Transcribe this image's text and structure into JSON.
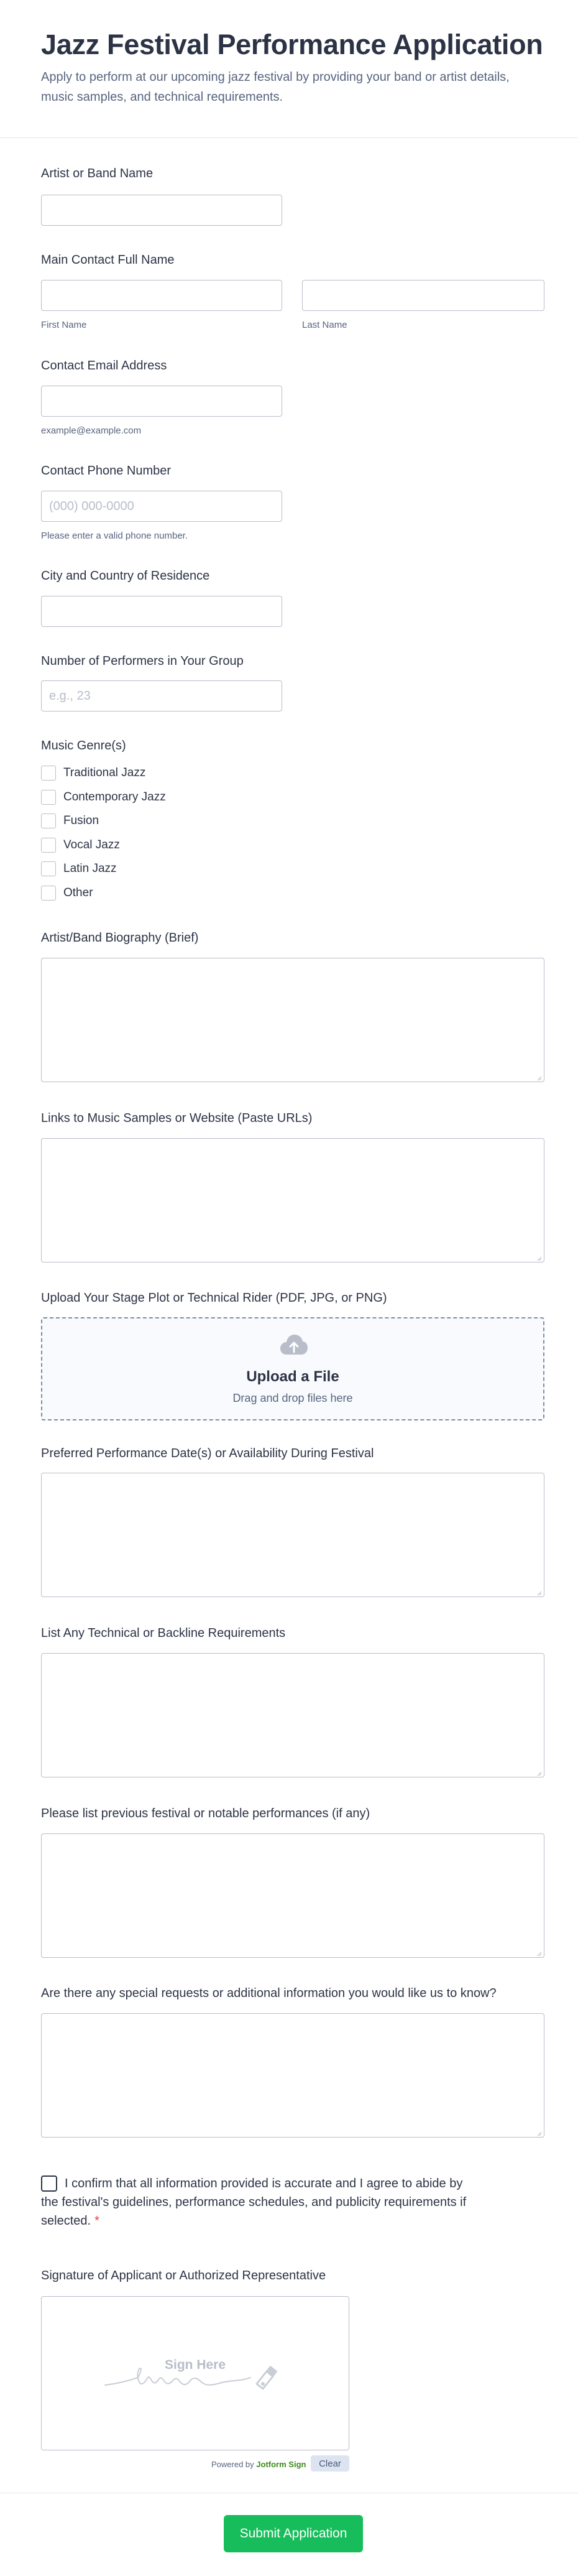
{
  "form": {
    "title": "Jazz Festival Performance Application",
    "subtitle": "Apply to perform at our upcoming jazz festival by providing your band or artist details, music samples, and technical requirements."
  },
  "fields": {
    "artist_name": {
      "label": "Artist or Band Name",
      "value": ""
    },
    "contact_name": {
      "label": "Main Contact Full Name",
      "first_sublabel": "First Name",
      "last_sublabel": "Last Name"
    },
    "email": {
      "label": "Contact Email Address",
      "sublabel": "example@example.com"
    },
    "phone": {
      "label": "Contact Phone Number",
      "placeholder": "(000) 000-0000",
      "sublabel": "Please enter a valid phone number."
    },
    "city": {
      "label": "City and Country of Residence"
    },
    "performers": {
      "label": "Number of Performers in Your Group",
      "placeholder": "e.g., 23"
    },
    "genres": {
      "label": "Music Genre(s)",
      "options": [
        "Traditional Jazz",
        "Contemporary Jazz",
        "Fusion",
        "Vocal Jazz",
        "Latin Jazz",
        "Other"
      ]
    },
    "biography": {
      "label": "Artist/Band Biography (Brief)"
    },
    "links": {
      "label": "Links to Music Samples or Website (Paste URLs)"
    },
    "upload": {
      "label": "Upload Your Stage Plot or Technical Rider (PDF, JPG, or PNG)",
      "title": "Upload a File",
      "hint": "Drag and drop files here",
      "icon": "cloud-upload-icon"
    },
    "dates": {
      "label": "Preferred Performance Date(s) or Availability During Festival"
    },
    "technical": {
      "label": "List Any Technical or Backline Requirements"
    },
    "previous": {
      "label": "Please list previous festival or notable performances (if any)"
    },
    "special": {
      "label": "Are there any special requests or additional information you would like us to know?"
    },
    "consent": {
      "text": "I confirm that all information provided is accurate and I agree to abide by the festival's guidelines, performance schedules, and publicity requirements if selected.",
      "required_mark": "*"
    },
    "signature": {
      "label": "Signature of Applicant or Authorized Representative",
      "placeholder": "Sign Here",
      "powered_by": "Powered by",
      "brand": "Jotform Sign",
      "clear_label": "Clear"
    }
  },
  "submit": {
    "label": "Submit Application"
  },
  "colors": {
    "accent": "#18bd5b",
    "text": "#2c3345",
    "muted": "#57647e",
    "border": "#b8bdc9",
    "required": "#f23a3c"
  }
}
